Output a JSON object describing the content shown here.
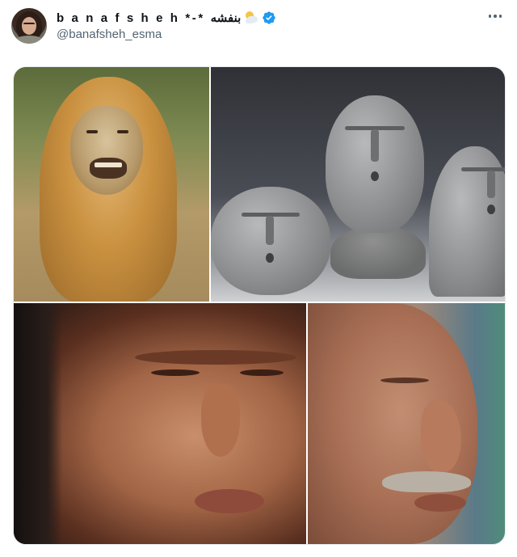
{
  "tweet": {
    "display_name": "b a n a f s h e h *-* بنفشه",
    "handle": "@banafsheh_esma",
    "name_emoji_icon": "moon-cloud-emoji-icon",
    "verified_icon": "verified-badge-icon",
    "more_icon": "more-dots-icon",
    "accent_color": "#1d9bf0"
  },
  "media": {
    "images": [
      {
        "name": "lion-grimace-image"
      },
      {
        "name": "stone-faces-image"
      },
      {
        "name": "squinting-man-image"
      },
      {
        "name": "squinting-mustache-man-image"
      }
    ]
  }
}
